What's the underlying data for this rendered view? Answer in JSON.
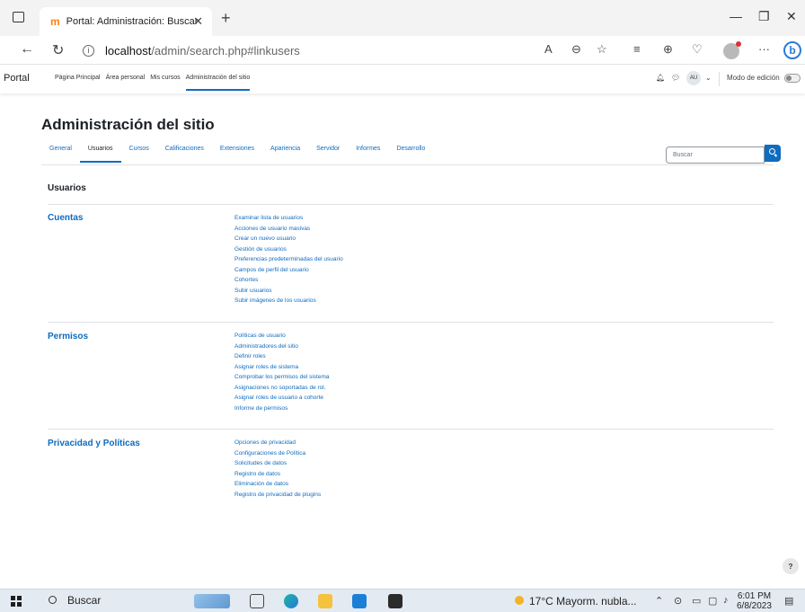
{
  "browser": {
    "tab_title": "Portal: Administración: Buscar",
    "tab_favicon": "m",
    "url_host": "localhost",
    "url_path": "/admin/search.php#linkusers"
  },
  "navbar": {
    "brand": "Portal",
    "links": [
      "Página Principal",
      "Área personal",
      "Mis cursos",
      "Administración del sitio"
    ],
    "user_initials": "AU",
    "edit_mode_label": "Modo de edición"
  },
  "page": {
    "title": "Administración del sitio",
    "search_placeholder": "Buscar",
    "tabs": [
      "General",
      "Usuarios",
      "Cursos",
      "Calificaciones",
      "Extensiones",
      "Apariencia",
      "Servidor",
      "Informes",
      "Desarrollo"
    ],
    "section_heading": "Usuarios"
  },
  "categories": [
    {
      "title": "Cuentas",
      "links": [
        "Examinar lista de usuarios",
        "Acciones de usuario masivas",
        "Crear un nuevo usuario",
        "Gestión de usuarios",
        "Preferencias predeterminadas del usuario",
        "Campos de perfil del usuario",
        "Cohortes",
        "Subir usuarios",
        "Subir imágenes de los usuarios"
      ]
    },
    {
      "title": "Permisos",
      "links": [
        "Políticas de usuario",
        "Administradores del sitio",
        "Definir roles",
        "Asignar roles de sistema",
        "Comprobar los permisos del sistema",
        "Asignaciones no soportadas de rol.",
        "Asignar roles de usuario a cohorte",
        "Informe de permisos"
      ]
    },
    {
      "title": "Privacidad y Políticas",
      "links": [
        "Opciones de privacidad",
        "Configuraciones de Política",
        "Solicitudes de datos",
        "Registro de datos",
        "Eliminación de datos",
        "Registro de privacidad de plugins"
      ]
    }
  ],
  "help_label": "?",
  "taskbar": {
    "search_label": "Buscar",
    "weather": "17°C  Mayorm. nubla...",
    "time": "6:01 PM",
    "date": "6/8/2023"
  }
}
